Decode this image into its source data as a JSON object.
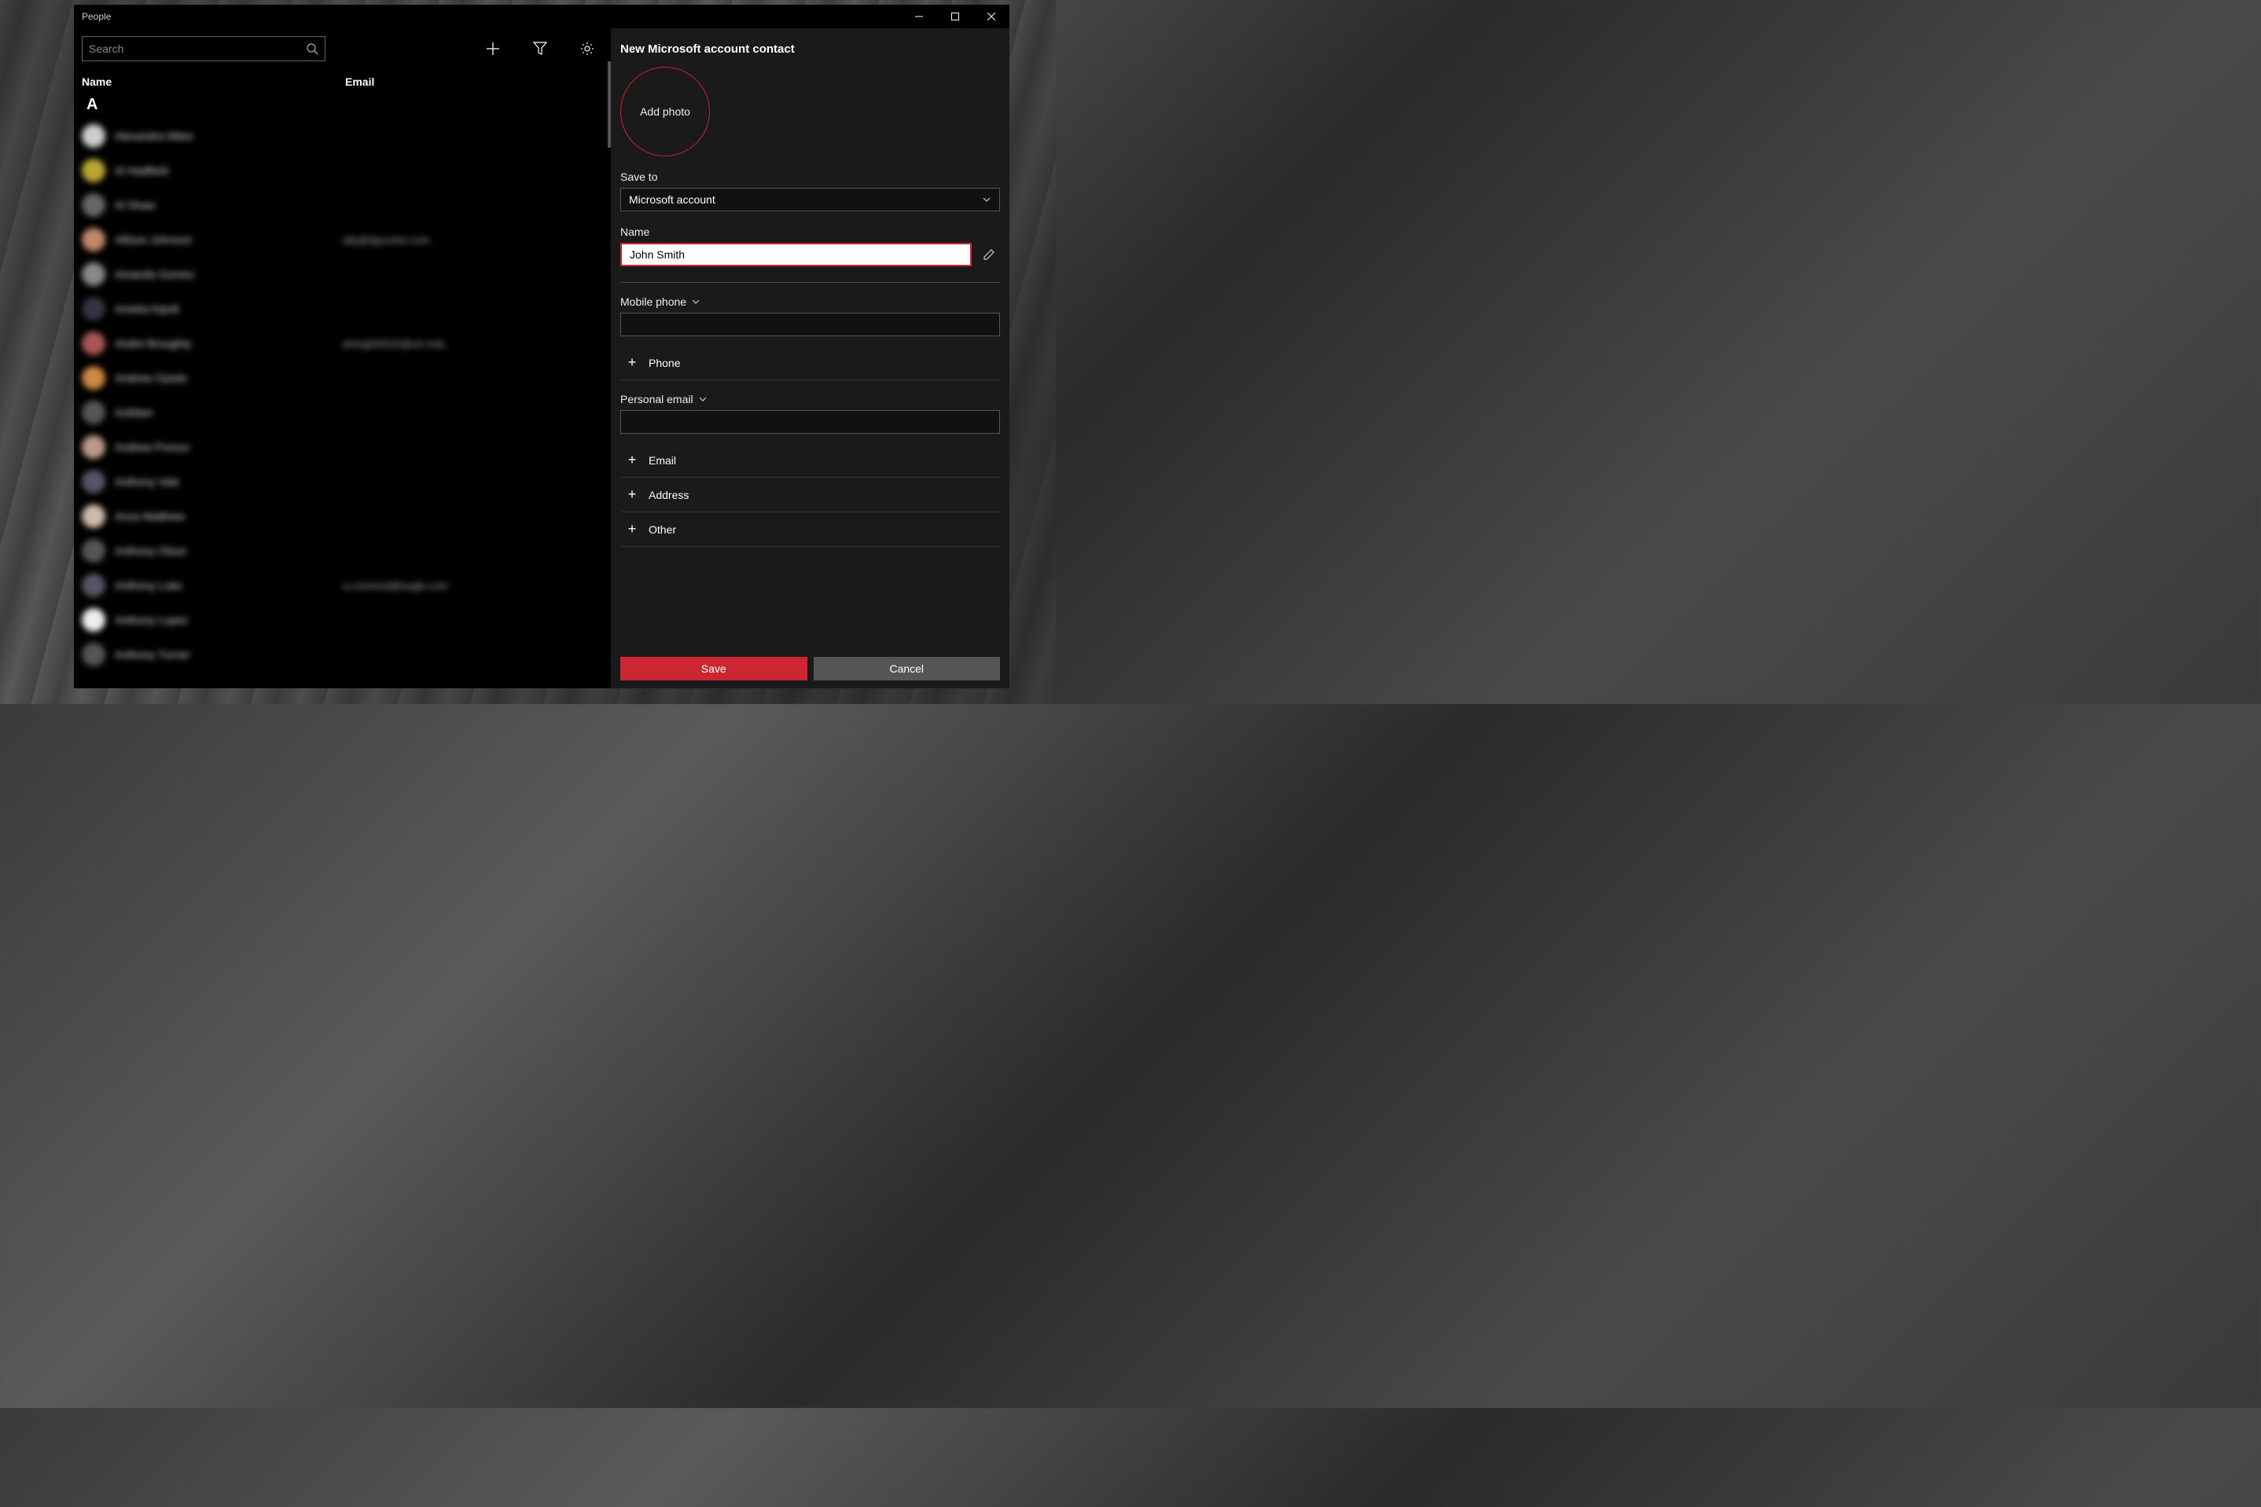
{
  "window": {
    "title": "People"
  },
  "search": {
    "placeholder": "Search"
  },
  "columns": {
    "name": "Name",
    "email": "Email"
  },
  "section_letter": "A",
  "contacts": [
    {
      "name": "Alexandra Miles",
      "email": "",
      "color": "#ccc"
    },
    {
      "name": "Al Hadfield",
      "email": "",
      "color": "#bba633"
    },
    {
      "name": "Al Shaw",
      "email": "",
      "color": "#666"
    },
    {
      "name": "Allison Johnson",
      "email": "ally@dgrocker.com",
      "color": "#c2876a"
    },
    {
      "name": "Amanda Gomez",
      "email": "",
      "color": "#888"
    },
    {
      "name": "Amelia Kipolt",
      "email": "",
      "color": "#334"
    },
    {
      "name": "Andre Broughty",
      "email": "pinsight2010@um.edu",
      "color": "#aa5555"
    },
    {
      "name": "Andrew Oyeds",
      "email": "",
      "color": "#cc8844"
    },
    {
      "name": "Anthber",
      "email": "",
      "color": "#555"
    },
    {
      "name": "Andrew Ponzur",
      "email": "",
      "color": "#bb9988"
    },
    {
      "name": "Anthony Vale",
      "email": "",
      "color": "#556"
    },
    {
      "name": "Anza Matthew",
      "email": "",
      "color": "#ccbbaa"
    },
    {
      "name": "Anthony Olson",
      "email": "",
      "color": "#555"
    },
    {
      "name": "Anthony Luke",
      "email": "a.commod@eagle.com",
      "color": "#556"
    },
    {
      "name": "Anthony Lopez",
      "email": "",
      "color": "#eee"
    },
    {
      "name": "Anthony Turner",
      "email": "",
      "color": "#555"
    }
  ],
  "panel": {
    "title": "New Microsoft account contact",
    "add_photo": "Add photo",
    "save_to_label": "Save to",
    "save_to_value": "Microsoft account",
    "name_label": "Name",
    "name_value": "John Smith",
    "mobile_label": "Mobile phone",
    "add_phone": "Phone",
    "personal_email_label": "Personal email",
    "add_email": "Email",
    "add_address": "Address",
    "add_other": "Other",
    "save": "Save",
    "cancel": "Cancel"
  }
}
